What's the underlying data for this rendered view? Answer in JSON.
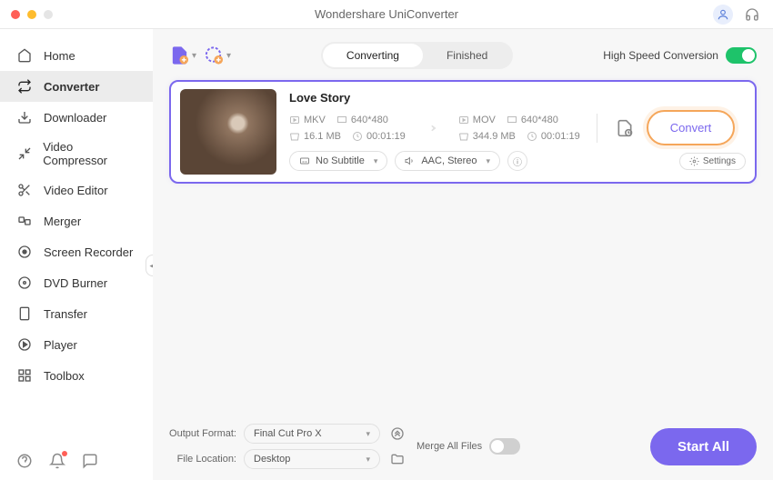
{
  "window": {
    "title": "Wondershare UniConverter"
  },
  "colors": {
    "close": "#ff5f57",
    "min": "#febc2e",
    "max": "#e5e5e5",
    "accent": "#7b68ee",
    "highlight": "#f5a65a",
    "toggle_on": "#1ec36a"
  },
  "sidebar": {
    "items": [
      {
        "label": "Home"
      },
      {
        "label": "Converter"
      },
      {
        "label": "Downloader"
      },
      {
        "label": "Video Compressor"
      },
      {
        "label": "Video Editor"
      },
      {
        "label": "Merger"
      },
      {
        "label": "Screen Recorder"
      },
      {
        "label": "DVD Burner"
      },
      {
        "label": "Transfer"
      },
      {
        "label": "Player"
      },
      {
        "label": "Toolbox"
      }
    ],
    "active_index": 1
  },
  "tabs": {
    "items": [
      "Converting",
      "Finished"
    ],
    "active_index": 0
  },
  "high_speed": {
    "label": "High Speed Conversion",
    "on": true
  },
  "file": {
    "title": "Love Story",
    "source": {
      "format": "MKV",
      "resolution": "640*480",
      "size": "16.1 MB",
      "duration": "00:01:19"
    },
    "target": {
      "format": "MOV",
      "resolution": "640*480",
      "size": "344.9 MB",
      "duration": "00:01:19"
    },
    "subtitle": "No Subtitle",
    "audio": "AAC, Stereo",
    "settings_label": "Settings",
    "convert_label": "Convert"
  },
  "bottom": {
    "output_format_label": "Output Format:",
    "output_format_value": "Final Cut Pro X",
    "file_location_label": "File Location:",
    "file_location_value": "Desktop",
    "merge_label": "Merge All Files",
    "merge_on": false,
    "start_label": "Start All"
  }
}
